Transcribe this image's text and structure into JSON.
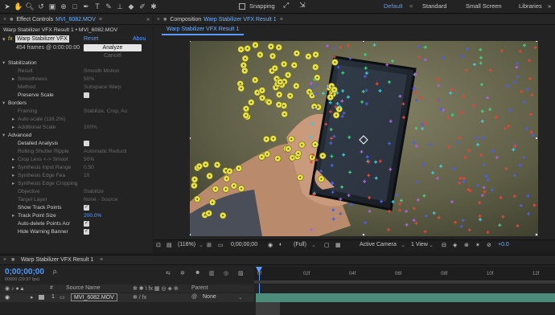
{
  "toolbar": {
    "snapping_label": "Snapping",
    "workspaces": [
      "Default",
      "Standard",
      "Small Screen",
      "Libraries"
    ],
    "active_workspace": "Default",
    "menu_glyph": "≡",
    "more_glyph": "»"
  },
  "effect_panel": {
    "tab_title": "Effect Controls",
    "tab_file": "MVI_6082.MOV",
    "layer_path": "Warp Stabilizer VFX Result 1 • MVI_6082.MOV",
    "effect_name": "Warp Stabilizer VFX",
    "reset_label": "Reset",
    "about_label": "Abou",
    "fx_label": "fx",
    "frames_info": "454 frames @ 0:00:00:00",
    "analyze_label": "Analyze",
    "cancel_label": "Cancel",
    "rows": [
      {
        "indent": 1,
        "tri": "▾",
        "label": "Stabilization",
        "value": "",
        "type": "section"
      },
      {
        "indent": 2,
        "tri": "",
        "label": "Result",
        "value": "Smooth Motion",
        "type": "dim"
      },
      {
        "indent": 2,
        "tri": "▸",
        "label": "Smoothness",
        "value": "50%",
        "type": "dim"
      },
      {
        "indent": 2,
        "tri": "",
        "label": "Method",
        "value": "Subspace Warp",
        "type": "dim"
      },
      {
        "indent": 2,
        "tri": "",
        "label": "Preserve Scale",
        "value": "",
        "type": "checkbox_off"
      },
      {
        "indent": 1,
        "tri": "▾",
        "label": "Borders",
        "value": "",
        "type": "section"
      },
      {
        "indent": 2,
        "tri": "",
        "label": "Framing",
        "value": "Stabilize, Crop, Au",
        "type": "dim"
      },
      {
        "indent": 2,
        "tri": "▸",
        "label": "Auto-scale (116.2%)",
        "value": "",
        "type": "dim"
      },
      {
        "indent": 2,
        "tri": "▸",
        "label": "Additional Scale",
        "value": "100%",
        "type": "dim"
      },
      {
        "indent": 1,
        "tri": "▾",
        "label": "Advanced",
        "value": "",
        "type": "section"
      },
      {
        "indent": 2,
        "tri": "",
        "label": "Detailed Analysis",
        "value": "",
        "type": "checkbox_off"
      },
      {
        "indent": 2,
        "tri": "",
        "label": "Rolling Shutter Ripple",
        "value": "Automatic Reducti",
        "type": "dim"
      },
      {
        "indent": 2,
        "tri": "▸",
        "label": "Crop Less <-> Smoot",
        "value": "50%",
        "type": "dim"
      },
      {
        "indent": 2,
        "tri": "▸",
        "label": "Synthesis Input Range",
        "value": "0.50",
        "type": "dim"
      },
      {
        "indent": 2,
        "tri": "▸",
        "label": "Synthesis Edge Fea",
        "value": "10",
        "type": "dim"
      },
      {
        "indent": 2,
        "tri": "▸",
        "label": "Synthesis Edge Cropping",
        "value": "",
        "type": "dim"
      },
      {
        "indent": 2,
        "tri": "",
        "label": "Objective",
        "value": "Stabilize",
        "type": "dim"
      },
      {
        "indent": 2,
        "tri": "",
        "label": "Target Layer",
        "value": "None  ·  Source",
        "type": "dim"
      },
      {
        "indent": 2,
        "tri": "",
        "label": "Show Track Points",
        "value": "",
        "type": "checkbox_on"
      },
      {
        "indent": 2,
        "tri": "▸",
        "label": "Track Point Size",
        "value": "200.0%",
        "type": "blue"
      },
      {
        "indent": 2,
        "tri": "",
        "label": "Auto-delete Points Acr",
        "value": "",
        "type": "checkbox_on"
      },
      {
        "indent": 2,
        "tri": "",
        "label": "Hide Warning Banner",
        "value": "",
        "type": "checkbox_on"
      }
    ]
  },
  "composition": {
    "tab_title": "Composition",
    "tab_name": "Warp Stabilizer VFX Result 1",
    "comp_tab": "Warp Stabilizer VFX Result 1",
    "zoom": "(116%)",
    "timecode": "0;00;00;00",
    "resolution": "(Full)",
    "camera": "Active Camera",
    "views": "1 View",
    "exposure": "+0.0"
  },
  "timeline": {
    "tab_title": "Warp Stabilizer VFX Result 1",
    "timecode": "0;00;00;00",
    "frame_info": "00000 (29.97 fps)",
    "search_glyph": "ρ.",
    "col_num": "#",
    "col_source": "Source Name",
    "col_parent": "Parent",
    "layer_num": "1",
    "layer_name": "MVI_6082.MOV",
    "parent_value": "None",
    "ruler_marks": [
      "0f",
      "02f",
      "04f",
      "06f",
      "08f",
      "10f",
      "12f"
    ]
  },
  "colors": {
    "accent": "#5a9bff",
    "track_yellow": "#e8e24a",
    "track_red": "#e0463a",
    "track_blue": "#4d5fe0",
    "track_green": "#3fd07a",
    "track_cyan": "#42c8d8",
    "track_purple": "#b060e0"
  }
}
